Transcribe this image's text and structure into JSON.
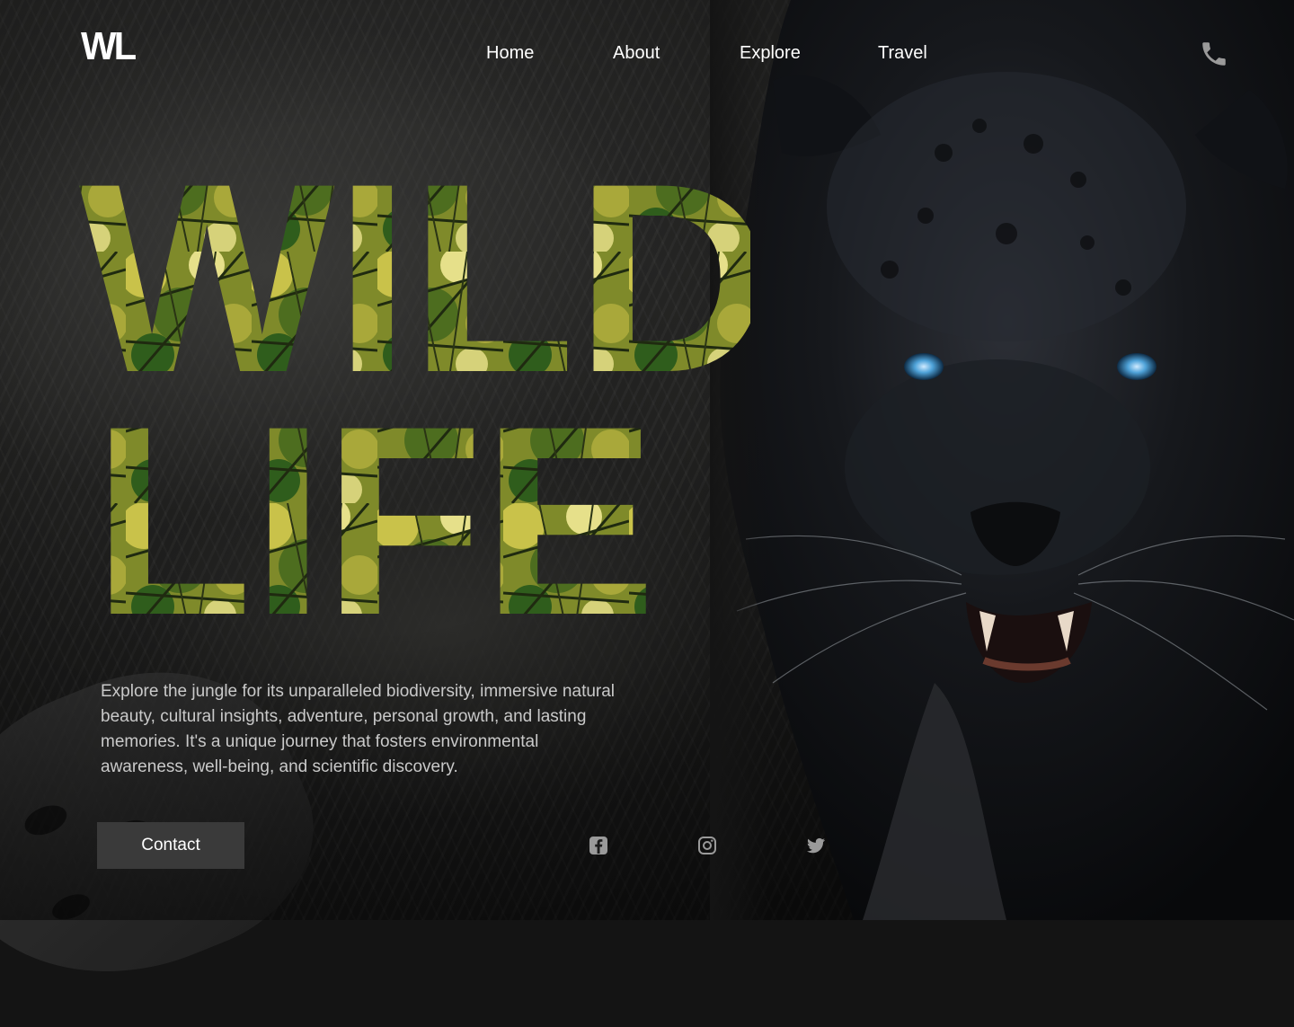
{
  "brand": {
    "logo": "WL"
  },
  "nav": {
    "items": [
      {
        "label": "Home"
      },
      {
        "label": "About"
      },
      {
        "label": "Explore"
      },
      {
        "label": "Travel"
      }
    ],
    "phone_icon": "phone-icon"
  },
  "hero": {
    "title_line1": "WILD",
    "title_line2": "LIFE",
    "description": "Explore the jungle for its unparalleled biodiversity, immersive natural beauty, cultural insights, adventure, personal growth, and lasting memories. It's a unique journey that fosters environmental awareness, well-being, and scientific discovery.",
    "cta_label": "Contact"
  },
  "social": [
    {
      "icon": "facebook-icon"
    },
    {
      "icon": "instagram-icon"
    },
    {
      "icon": "twitter-icon"
    }
  ],
  "colors": {
    "background": "#141414",
    "text": "#ffffff",
    "description_text": "#c9c9c9",
    "button_bg": "#3a3a3a",
    "panther_eye": "#4fa3d9",
    "foliage_light": "#c9c24a",
    "foliage_dark": "#2f5d1c"
  }
}
